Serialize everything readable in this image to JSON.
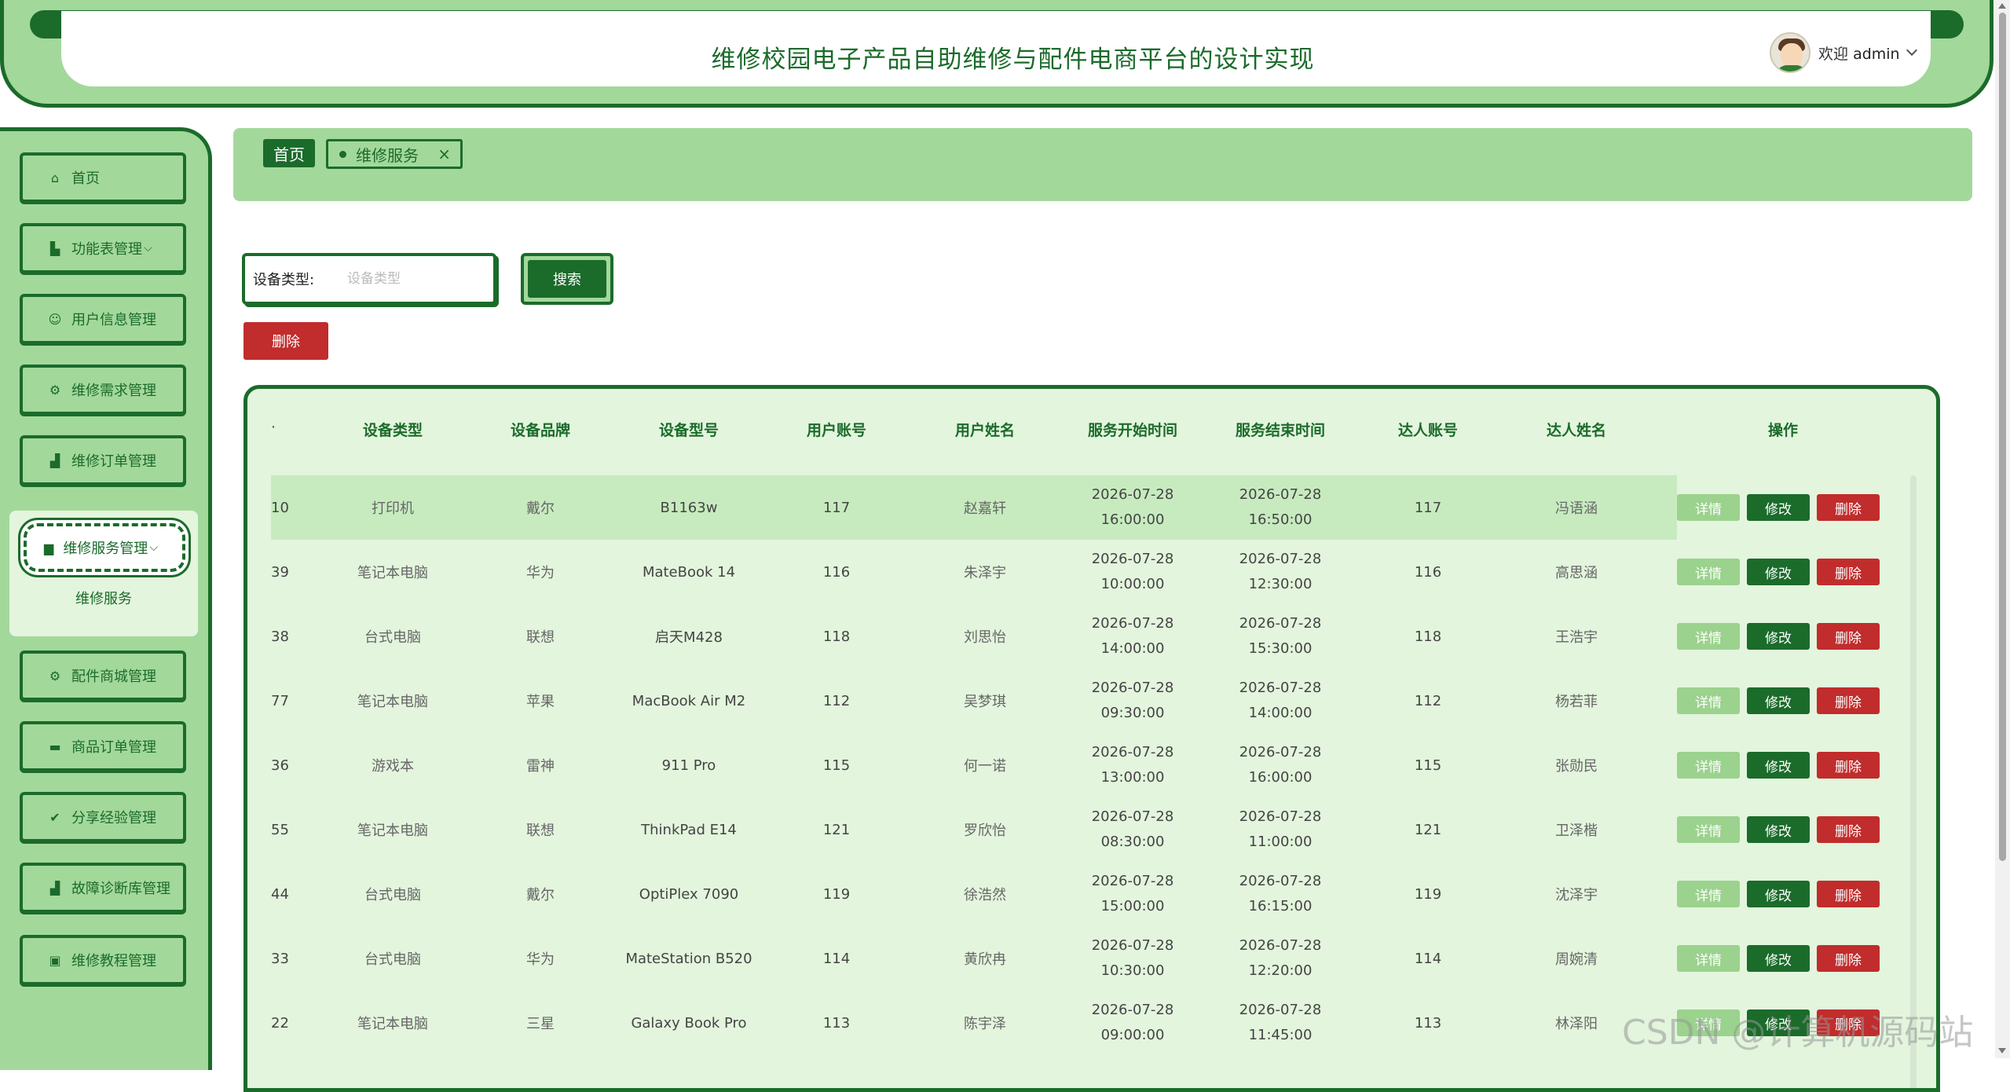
{
  "header": {
    "title": "维修校园电子产品自助维修与配件电商平台的设计实现",
    "welcome_prefix": "欢迎",
    "username": "admin"
  },
  "sidebar": {
    "items": [
      {
        "label": "首页",
        "icon": "home-icon",
        "glyph": "⌂"
      },
      {
        "label": "功能表管理",
        "icon": "chart-icon",
        "glyph": "▙",
        "chevron": "⌵"
      },
      {
        "label": "用户信息管理",
        "icon": "user-icon",
        "glyph": "☺"
      },
      {
        "label": "维修需求管理",
        "icon": "tool-icon",
        "glyph": "⚙"
      },
      {
        "label": "维修订单管理",
        "icon": "cart-icon",
        "glyph": "▟"
      },
      {
        "label": "维修服务管理",
        "icon": "folder-icon",
        "glyph": "▆",
        "chevron": "⌵"
      },
      {
        "label": "配件商城管理",
        "icon": "shop-icon",
        "glyph": "⚙"
      },
      {
        "label": "商品订单管理",
        "icon": "list-icon",
        "glyph": "▬"
      },
      {
        "label": "分享经验管理",
        "icon": "check-icon",
        "glyph": "✔"
      },
      {
        "label": "故障诊断库管理",
        "icon": "cart-icon",
        "glyph": "▟"
      },
      {
        "label": "维修教程管理",
        "icon": "book-icon",
        "glyph": "▣"
      }
    ],
    "sub_item": "维修服务"
  },
  "breadcrumb": {
    "home": "首页",
    "tab": "维修服务",
    "close": "×"
  },
  "search": {
    "label": "设备类型:",
    "placeholder": "设备类型",
    "button": "搜索"
  },
  "toolbar": {
    "delete": "删除"
  },
  "table": {
    "headers": [
      "·",
      "设备类型",
      "设备品牌",
      "设备型号",
      "用户账号",
      "用户姓名",
      "服务开始时间",
      "服务结束时间",
      "达人账号",
      "达人姓名",
      "操作"
    ],
    "ops": {
      "detail": "详情",
      "edit": "修改",
      "delete": "删除"
    },
    "rows": [
      {
        "id": "10",
        "type": "打印机",
        "brand": "戴尔",
        "model": "B1163w",
        "uacc": "117",
        "uname": "赵嘉轩",
        "start": "2026-07-28 16:00:00",
        "end": "2026-07-28 16:50:00",
        "eacc": "117",
        "ename": "冯语涵"
      },
      {
        "id": "39",
        "type": "笔记本电脑",
        "brand": "华为",
        "model": "MateBook 14",
        "uacc": "116",
        "uname": "朱泽宇",
        "start": "2026-07-28 10:00:00",
        "end": "2026-07-28 12:30:00",
        "eacc": "116",
        "ename": "高思涵"
      },
      {
        "id": "38",
        "type": "台式电脑",
        "brand": "联想",
        "model": "启天M428",
        "uacc": "118",
        "uname": "刘思怡",
        "start": "2026-07-28 14:00:00",
        "end": "2026-07-28 15:30:00",
        "eacc": "118",
        "ename": "王浩宇"
      },
      {
        "id": "77",
        "type": "笔记本电脑",
        "brand": "苹果",
        "model": "MacBook Air M2",
        "uacc": "112",
        "uname": "吴梦琪",
        "start": "2026-07-28 09:30:00",
        "end": "2026-07-28 14:00:00",
        "eacc": "112",
        "ename": "杨若菲"
      },
      {
        "id": "36",
        "type": "游戏本",
        "brand": "雷神",
        "model": "911 Pro",
        "uacc": "115",
        "uname": "何一诺",
        "start": "2026-07-28 13:00:00",
        "end": "2026-07-28 16:00:00",
        "eacc": "115",
        "ename": "张勋民"
      },
      {
        "id": "55",
        "type": "笔记本电脑",
        "brand": "联想",
        "model": "ThinkPad E14",
        "uacc": "121",
        "uname": "罗欣怡",
        "start": "2026-07-28 08:30:00",
        "end": "2026-07-28 11:00:00",
        "eacc": "121",
        "ename": "卫泽楷"
      },
      {
        "id": "44",
        "type": "台式电脑",
        "brand": "戴尔",
        "model": "OptiPlex 7090",
        "uacc": "119",
        "uname": "徐浩然",
        "start": "2026-07-28 15:00:00",
        "end": "2026-07-28 16:15:00",
        "eacc": "119",
        "ename": "沈泽宇"
      },
      {
        "id": "33",
        "type": "台式电脑",
        "brand": "华为",
        "model": "MateStation B520",
        "uacc": "114",
        "uname": "黄欣冉",
        "start": "2026-07-28 10:30:00",
        "end": "2026-07-28 12:20:00",
        "eacc": "114",
        "ename": "周婉清"
      },
      {
        "id": "22",
        "type": "笔记本电脑",
        "brand": "三星",
        "model": "Galaxy Book Pro",
        "uacc": "113",
        "uname": "陈宇泽",
        "start": "2026-07-28 09:00:00",
        "end": "2026-07-28 11:45:00",
        "eacc": "113",
        "ename": "林泽阳"
      }
    ]
  },
  "watermark": "CSDN @计算机源码站"
}
